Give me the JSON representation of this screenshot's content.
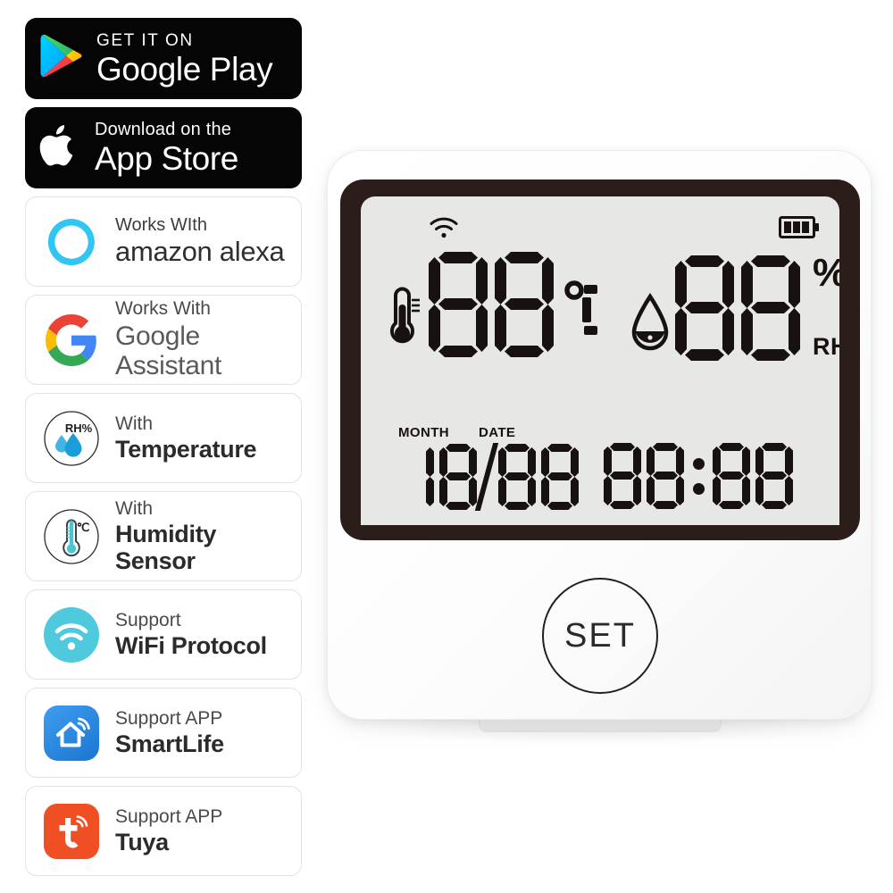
{
  "badges": {
    "store": [
      {
        "id": "google-play",
        "small": "GET IT ON",
        "large": "Google Play",
        "icon": "google-play-icon"
      },
      {
        "id": "app-store",
        "small": "Download on the",
        "large": "App Store",
        "icon": "apple-logo-icon"
      }
    ],
    "features": [
      {
        "id": "alexa",
        "top": "Works WIth",
        "bottom": "amazon alexa",
        "icon": "amazon-alexa-icon",
        "color": "#33c3ef"
      },
      {
        "id": "google",
        "top": "Works With",
        "bottom": "Google Assistant",
        "icon": "google-g-icon",
        "color": "#4285f4"
      },
      {
        "id": "temperature",
        "top": "With",
        "bottom": "Temperature",
        "icon": "humidity-droplets-icon",
        "color": "#29a8e0",
        "badge_text": "RH%"
      },
      {
        "id": "humidity",
        "top": "With",
        "bottom": "Humidity Sensor",
        "icon": "thermometer-icon",
        "color": "#3ec6d4",
        "badge_text": "℃"
      },
      {
        "id": "wifi",
        "top": "Support",
        "bottom": "WiFi Protocol",
        "icon": "wifi-icon",
        "color": "#4bc8dd"
      },
      {
        "id": "smartlife",
        "top": "Support APP",
        "bottom": "SmartLife",
        "icon": "smart-life-app-icon",
        "color": "#2f8ee0"
      },
      {
        "id": "tuya",
        "top": "Support APP",
        "bottom": "Tuya",
        "icon": "tuya-app-icon",
        "color": "#f04e23"
      }
    ]
  },
  "device": {
    "name": "wifi-temperature-humidity-sensor",
    "colors": {
      "shell": "#ffffff",
      "bezel": "#2b1d19",
      "lcd_background": "#e7e7e5",
      "lcd_segment": "#17120f"
    },
    "lcd": {
      "wifi_indicator": "wifi-signal-icon",
      "battery_indicator": "battery-full-icon",
      "battery_bars": 3,
      "temperature": {
        "icon": "thermometer-icon",
        "digits": "88",
        "unit": "℃"
      },
      "humidity": {
        "icon": "water-drop-icon",
        "digits": "88",
        "unit_percent": "%",
        "unit_rh": "RH"
      },
      "date": {
        "month_label": "MONTH",
        "date_label": "DATE",
        "month_digits": "18",
        "day_digits": "88",
        "separator": "/"
      },
      "clock": {
        "hours": "88",
        "minutes": "88",
        "separator": ":"
      }
    },
    "set_button_label": "SET"
  }
}
